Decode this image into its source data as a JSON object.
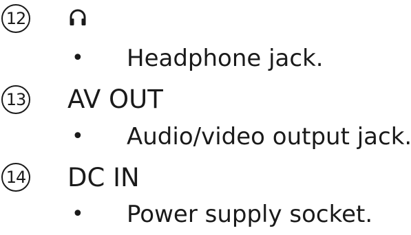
{
  "items": [
    {
      "number": "12",
      "icon": "headphone-icon",
      "description": "Headphone jack."
    },
    {
      "number": "13",
      "heading": "AV OUT",
      "description": "Audio/video output jack."
    },
    {
      "number": "14",
      "heading": "DC IN",
      "description": "Power supply socket."
    }
  ],
  "bullet_char": "•"
}
